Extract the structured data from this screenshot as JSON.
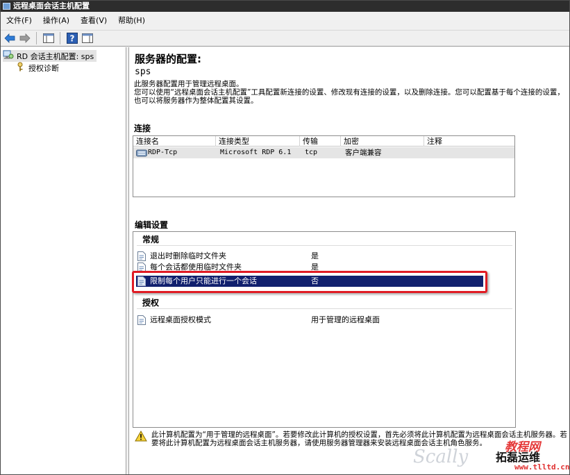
{
  "window": {
    "title": "远程桌面会话主机配置"
  },
  "menu": {
    "items": [
      "文件(F)",
      "操作(A)",
      "查看(V)",
      "帮助(H)"
    ]
  },
  "tree": {
    "root_label": "RD 会话主机配置: sps",
    "child_label": "授权诊断"
  },
  "main": {
    "heading": "服务器的配置:",
    "server_name": "sps",
    "description_line1": "此服务器配置用于管理远程桌面。",
    "description_line2": "您可以使用“远程桌面会话主机配置”工具配置新连接的设置、修改现有连接的设置，以及删除连接。您可以配置基于每个连接的设置，也可以将服务器作为整体配置其设置。"
  },
  "connections": {
    "section_title": "连接",
    "columns": [
      "连接名",
      "连接类型",
      "传输",
      "加密",
      "注释"
    ],
    "rows": [
      {
        "name": "RDP-Tcp",
        "type": "Microsoft RDP 6.1",
        "transport": "tcp",
        "encryption": "客户端兼容",
        "comment": ""
      }
    ]
  },
  "edit_settings": {
    "section_title": "编辑设置",
    "general": {
      "label": "常规",
      "rows": [
        {
          "name": "退出时删除临时文件夹",
          "value": "是"
        },
        {
          "name": "每个会话都使用临时文件夹",
          "value": "是"
        },
        {
          "name": "限制每个用户只能进行一个会话",
          "value": "否"
        }
      ]
    },
    "licensing": {
      "label": "授权",
      "rows": [
        {
          "name": "远程桌面授权模式",
          "value": "用于管理的远程桌面"
        }
      ]
    }
  },
  "warning": {
    "text": "此计算机配置为“用于管理的远程桌面”。若要修改此计算机的授权设置，首先必须将此计算机配置为远程桌面会话主机服务器。若要将此计算机配置为远程桌面会话主机服务器，请使用服务器管理器来安装远程桌面会话主机角色服务。"
  },
  "watermark": {
    "left": "Scally",
    "right_top": "教程网",
    "right_mid": "拓磊运维",
    "right_bottom": "www.tlltd.cn"
  },
  "colors": {
    "selection": "#11206e",
    "highlight": "#e01b24",
    "titlebar": "#2d2d2d"
  }
}
